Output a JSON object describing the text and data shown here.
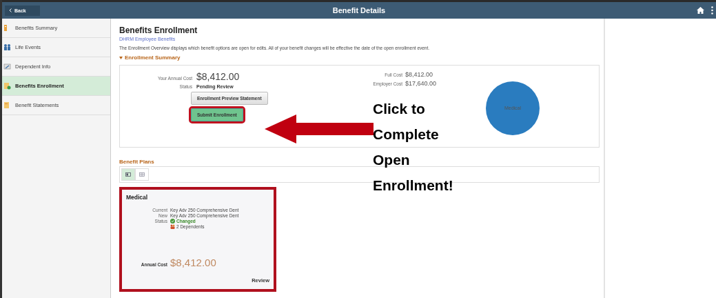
{
  "header": {
    "back": "Back",
    "title": "Benefit Details"
  },
  "sidebar": {
    "items": [
      {
        "label": "Benefits Summary",
        "selected": false
      },
      {
        "label": "Life Events",
        "selected": false
      },
      {
        "label": "Dependent Info",
        "selected": false
      },
      {
        "label": "Benefits Enrollment",
        "selected": true
      },
      {
        "label": "Benefit Statements",
        "selected": false
      }
    ]
  },
  "main": {
    "title": "Benefits Enrollment",
    "subtitle": "DHRM Employee Benefits",
    "description": "The Enrollment Overview displays which benefit options are open for edits. All of your benefit changes will be effective the date of the open enrollment event.",
    "summary": {
      "heading": "Enrollment Summary",
      "expanded": true,
      "fields_left": [
        {
          "label": "Your Annual Cost",
          "value": "$8,412.00",
          "kind": "large"
        },
        {
          "label": "Status",
          "value": "Pending Review",
          "kind": "bold"
        }
      ],
      "fields_right": [
        {
          "label": "Full Cost",
          "value": "$8,412.00"
        },
        {
          "label": "Employer Cost",
          "value": "$17,640.00"
        }
      ],
      "buttons": [
        {
          "label": "Enrollment Preview Statement",
          "kind": "secondary",
          "highlighted": false
        },
        {
          "label": "Submit Enrollment",
          "kind": "primary",
          "highlighted": true
        }
      ],
      "pie_label": "Medical"
    },
    "plans": {
      "heading": "Benefit Plans",
      "views": [
        {
          "kind": "tiles",
          "selected": true
        },
        {
          "kind": "grid",
          "selected": false
        }
      ],
      "cards": [
        {
          "title": "Medical",
          "highlighted": true,
          "rows": [
            {
              "label": "Current",
              "value": "Key Adv 250 Comprehensive Dent",
              "kind": "text"
            },
            {
              "label": "New",
              "value": "Key Adv 250 Comprehensive Dent",
              "kind": "text"
            },
            {
              "label": "Status",
              "value": "Changed",
              "kind": "status"
            },
            {
              "value": "2 Dependents",
              "kind": "dependents"
            }
          ],
          "cost_label": "Annual Cost",
          "cost": "$8,412.00",
          "action": "Review"
        }
      ]
    }
  },
  "callout": {
    "text": "Click to Complete Open Enrollment!"
  }
}
